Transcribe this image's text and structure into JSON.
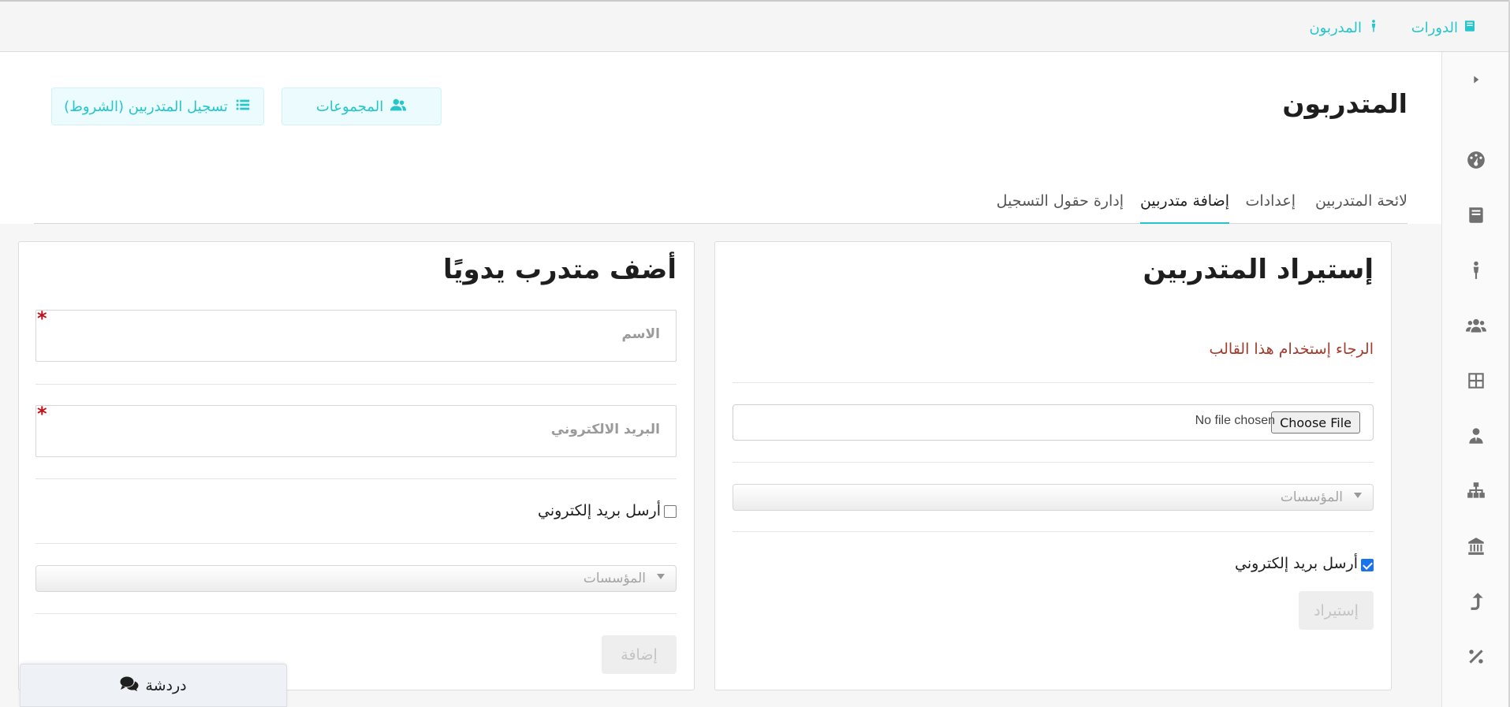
{
  "topnav": {
    "courses_label": "الدورات",
    "trainees_label": "المدربون"
  },
  "header": {
    "title": "المتدربون",
    "groups_button": "المجموعات",
    "register_button": "تسجيل المتدربين (الشروط)"
  },
  "tabs": [
    {
      "label": "لائحة المتدربين",
      "active": false
    },
    {
      "label": "إعدادات",
      "active": false
    },
    {
      "label": "إضافة متدربين",
      "active": true
    },
    {
      "label": "إدارة حقول التسجيل",
      "active": false
    }
  ],
  "import_card": {
    "title": "إستيراد المتدربين",
    "template_link": "الرجاء إستخدام هذا القالب",
    "file_button": "Choose File",
    "file_status": "No file chosen",
    "institutions_placeholder": "المؤسسات",
    "send_email_label": "أرسل بريد إلكتروني",
    "send_email_checked": true,
    "submit_button": "إستيراد"
  },
  "manual_card": {
    "title": "أضف متدرب يدويًا",
    "name_placeholder": "الاسم",
    "email_placeholder": "البريد الالكتروني",
    "required_mark": "*",
    "send_email_label": "أرسل بريد إلكتروني",
    "send_email_checked": false,
    "institutions_placeholder": "المؤسسات",
    "submit_button": "إضافة"
  },
  "chat": {
    "label": "دردشة"
  },
  "rail_icons": [
    "caret-right-icon",
    "dashboard-icon",
    "book-icon",
    "person-icon",
    "users-icon",
    "table-icon",
    "user-tie-icon",
    "sitemap-icon",
    "building-icon",
    "share-icon",
    "percent-icon"
  ],
  "colors": {
    "accent": "#24c6cc",
    "link_red": "#a33a2e",
    "required": "#c0101a"
  }
}
